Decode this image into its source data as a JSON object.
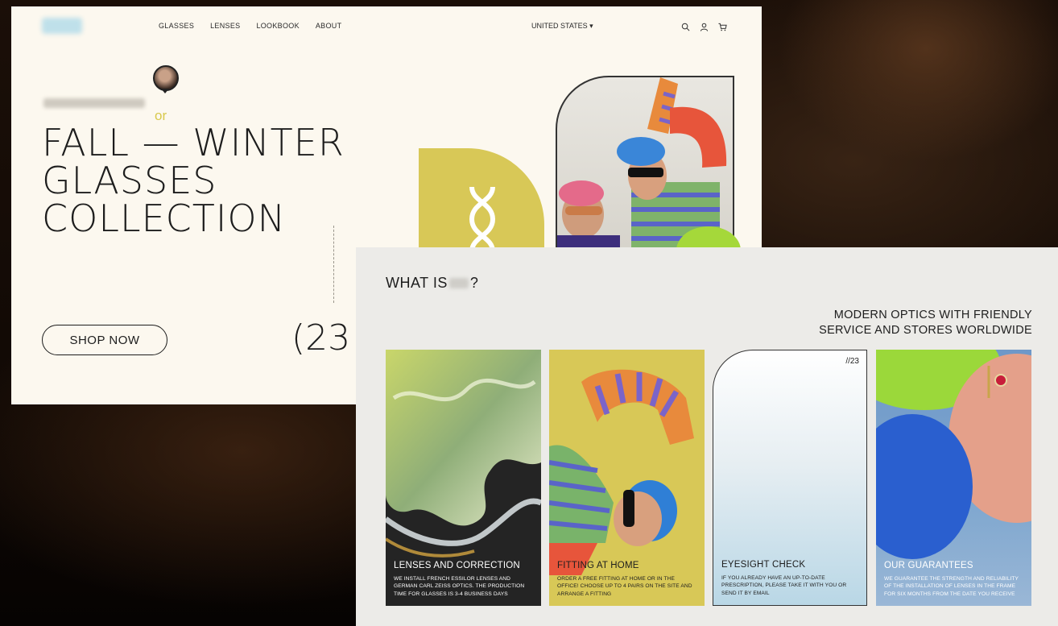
{
  "top_screen": {
    "nav": [
      "GLASSES",
      "LENSES",
      "LOOKBOOK",
      "ABOUT"
    ],
    "country": "UNITED STATES ▾",
    "icons": [
      "search-icon",
      "user-icon",
      "cart-icon"
    ],
    "or_label": "or",
    "hero_title": "FALL — WINTER\nGLASSES\nCOLLECTION",
    "shop_button": "SHOP NOW",
    "counter": "(23"
  },
  "front_screen": {
    "heading_left": "WHAT IS",
    "heading_right": "?",
    "tagline_line1": "MODERN OPTICS WITH FRIENDLY",
    "tagline_line2": "SERVICE AND STORES WORLDWIDE",
    "cards": [
      {
        "title": "LENSES AND CORRECTION",
        "text": "WE INSTALL FRENCH ESSILOR LENSES AND GERMAN CARL ZEISS OPTICS. THE PRODUCTION TIME FOR GLASSES IS 3-4 BUSINESS DAYS"
      },
      {
        "title": "FITTING AT HOME",
        "text": "ORDER A FREE FITTING AT HOME OR IN THE OFFICE! CHOOSE UP TO 4 PAIRS ON THE SITE AND ARRANGE A FITTING"
      },
      {
        "title": "EYESIGHT CHECK",
        "number": "//23",
        "text": "IF YOU ALREADY HAVE AN UP-TO-DATE PRESCRIPTION, PLEASE TAKE IT WITH YOU OR SEND IT BY EMAIL"
      },
      {
        "title": "OUR GUARANTEES",
        "text": "WE GUARANTEE THE STRENGTH AND RELIABILITY OF THE INSTALLATION OF LENSES IN THE FRAME FOR SIX MONTHS FROM THE DATE YOU RECEIVE"
      }
    ]
  },
  "colors": {
    "cream": "#fcf8ef",
    "yellow_accent": "#d8c857",
    "lime": "#a5d83a",
    "sky_blue": "#7fa7cf",
    "dark": "#1d1d1d"
  }
}
